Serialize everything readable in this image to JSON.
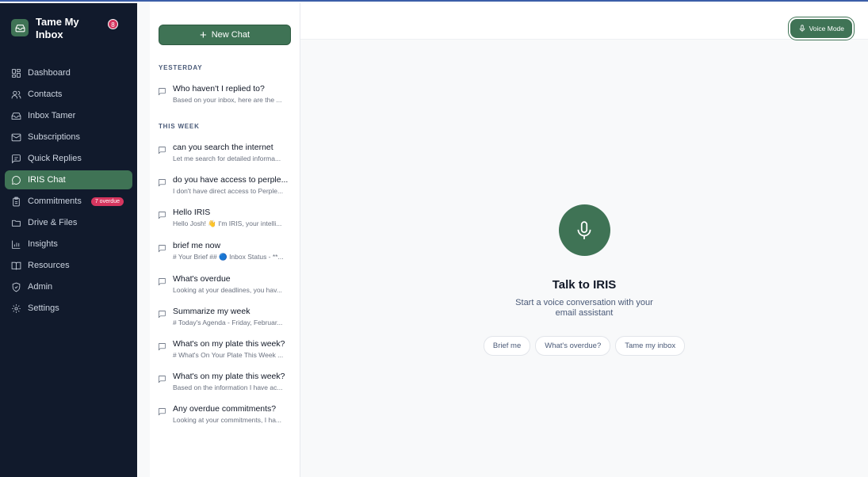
{
  "brand": {
    "name": "Tame My Inbox",
    "notifications": "8"
  },
  "nav": [
    {
      "label": "Dashboard",
      "icon": "dashboard-icon"
    },
    {
      "label": "Contacts",
      "icon": "users-icon"
    },
    {
      "label": "Inbox Tamer",
      "icon": "inbox-icon"
    },
    {
      "label": "Subscriptions",
      "icon": "mail-icon"
    },
    {
      "label": "Quick Replies",
      "icon": "reply-icon"
    },
    {
      "label": "IRIS Chat",
      "icon": "chat-icon",
      "active": true
    },
    {
      "label": "Commitments",
      "icon": "clipboard-icon",
      "badge": "7 overdue"
    },
    {
      "label": "Drive & Files",
      "icon": "folder-icon"
    },
    {
      "label": "Insights",
      "icon": "chart-icon"
    },
    {
      "label": "Resources",
      "icon": "book-icon"
    },
    {
      "label": "Admin",
      "icon": "shield-icon"
    },
    {
      "label": "Settings",
      "icon": "gear-icon"
    }
  ],
  "history": {
    "new_chat": "New Chat",
    "yesterday_label": "YESTERDAY",
    "this_week_label": "THIS WEEK",
    "yesterday": [
      {
        "title": "Who haven't I replied to?",
        "preview": "Based on your inbox, here are the ..."
      }
    ],
    "this_week": [
      {
        "title": "can you search the internet",
        "preview": "Let me search for detailed informa..."
      },
      {
        "title": "do you have access to perple...",
        "preview": "I don't have direct access to Perple..."
      },
      {
        "title": "Hello IRIS",
        "preview": "Hello Josh! 👋 I'm IRIS, your intelli..."
      },
      {
        "title": "brief me now",
        "preview": "# Your Brief ## 🔵 Inbox Status - **..."
      },
      {
        "title": "What's overdue",
        "preview": "Looking at your deadlines, you hav..."
      },
      {
        "title": "Summarize my week",
        "preview": "# Today's Agenda - Friday, Februar..."
      },
      {
        "title": "What's on my plate this week?",
        "preview": "# What's On Your Plate This Week ..."
      },
      {
        "title": "What's on my plate this week?",
        "preview": "Based on the information I have ac..."
      },
      {
        "title": "Any overdue commitments?",
        "preview": "Looking at your commitments, I ha..."
      }
    ]
  },
  "voice_mode": "Voice Mode",
  "main": {
    "title": "Talk to IRIS",
    "subtitle": "Start a voice conversation with your email assistant",
    "chips": [
      "Brief me",
      "What's overdue?",
      "Tame my inbox"
    ]
  }
}
